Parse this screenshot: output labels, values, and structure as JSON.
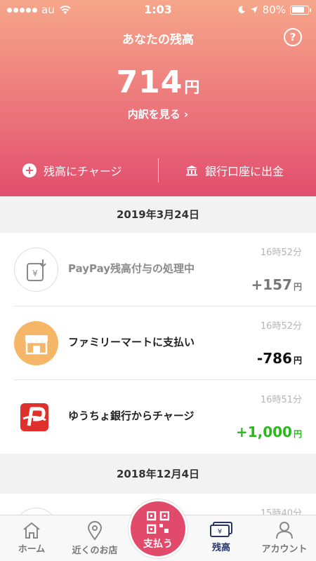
{
  "status_bar": {
    "carrier": "au",
    "time": "1:03",
    "battery": "80%"
  },
  "header": {
    "title": "あなたの残高",
    "help": "?",
    "balance_value": "714",
    "balance_unit": "円",
    "detail_link": "内訳を見る ›"
  },
  "actions": {
    "charge_label": "残高にチャージ",
    "withdraw_label": "銀行口座に出金"
  },
  "sections": [
    {
      "date": "2019年3月24日",
      "transactions": [
        {
          "title": "PayPay残高付与の処理中",
          "time": "16時52分",
          "amount": "+157",
          "unit": "円",
          "icon": "pending-yen-icon"
        },
        {
          "title": "ファミリーマートに支払い",
          "time": "16時52分",
          "amount": "-786",
          "unit": "円",
          "icon": "store-icon"
        },
        {
          "title": "ゆうちょ銀行からチャージ",
          "time": "16時51分",
          "amount": "+1,000",
          "unit": "円",
          "icon": "paypay-logo-icon"
        }
      ]
    },
    {
      "date": "2018年12月4日",
      "transactions": [
        {
          "title": "",
          "time": "15時40分",
          "amount": "",
          "unit": "",
          "icon": "pending-icon"
        }
      ]
    }
  ],
  "tabbar": {
    "home": "ホーム",
    "nearby": "近くのお店",
    "pay": "支払う",
    "balance": "残高",
    "account": "アカウント"
  },
  "colors": {
    "header_top": "#f6a68a",
    "header_bottom": "#e24e6e",
    "positive": "#2bb81e",
    "active_tab": "#2a3567",
    "pay_button": "#e24a6b"
  }
}
